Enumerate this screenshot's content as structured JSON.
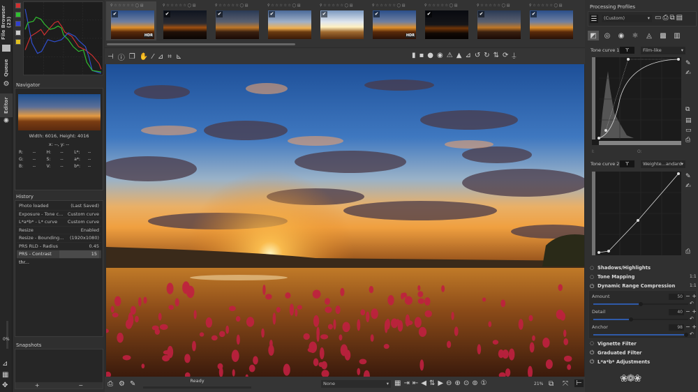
{
  "sidebar_tabs": {
    "file_browser": "File Browser (23)",
    "queue": "Queue",
    "editor": "Editor"
  },
  "histogram": {
    "swatches": [
      "#d03030",
      "#30c030",
      "#3040d0",
      "#cccccc",
      "#e0c020"
    ]
  },
  "navigator": {
    "title": "Navigator",
    "dimensions": "Width: 6016, Height: 4016",
    "coords": "x: --, y: --",
    "readouts": [
      [
        "R:",
        "--",
        "H:",
        "--",
        "L*:",
        "--"
      ],
      [
        "G:",
        "--",
        "S:",
        "--",
        "a*:",
        "--"
      ],
      [
        "B:",
        "--",
        "V:",
        "--",
        "b*:",
        "--"
      ]
    ]
  },
  "history": {
    "title": "History",
    "items": [
      {
        "label": "Photo loaded",
        "value": "(Last Saved)"
      },
      {
        "label": "Exposure - Tone c...",
        "value": "Custom curve"
      },
      {
        "label": "L*a*b* - L* curve",
        "value": "Custom curve"
      },
      {
        "label": "Resize",
        "value": "Enabled"
      },
      {
        "label": "Resize - Bounding...",
        "value": "(1920x1080)"
      },
      {
        "label": "PRS RLD - Radius",
        "value": "0.45"
      },
      {
        "label": "PRS - Contrast thr...",
        "value": "15",
        "selected": true
      }
    ]
  },
  "progress_label": "0%",
  "snapshots": {
    "title": "Snapshots",
    "add": "+",
    "remove": "−"
  },
  "filmstrip": [
    {
      "tone": "a",
      "hdr": true,
      "selected": true
    },
    {
      "tone": "d"
    },
    {
      "tone": "b"
    },
    {
      "tone": "c"
    },
    {
      "tone": "e"
    },
    {
      "tone": "a",
      "hdr": true
    },
    {
      "tone": "f"
    },
    {
      "tone": "b"
    },
    {
      "tone": "a"
    }
  ],
  "hdr_label": "HDR",
  "bottom": {
    "status": "Ready",
    "profile_select": "None",
    "zoom": "21%"
  },
  "right": {
    "title": "Processing Profiles",
    "profile": "(Custom)",
    "tone_curve_1": {
      "label": "Tone curve 1:",
      "type": "Film-like",
      "in_label": "I:",
      "out_label": "O:"
    },
    "tone_curve_2": {
      "label": "Tone curve 2:",
      "type": "Weighte...andard"
    },
    "sections": {
      "shadows": "Shadows/Highlights",
      "tone_mapping": "Tone Mapping",
      "drc": "Dynamic Range Compression",
      "vignette": "Vignette Filter",
      "graduated": "Graduated Filter",
      "lab": "L*a*b* Adjustments"
    },
    "ratio": "1:1",
    "sliders": [
      {
        "label": "Amount",
        "value": "50",
        "fraction": 0.5
      },
      {
        "label": "Detail",
        "value": "40",
        "fraction": 0.4
      },
      {
        "label": "Anchor",
        "value": "98",
        "fraction": 0.98
      }
    ]
  },
  "accent": "#2f5aa8"
}
